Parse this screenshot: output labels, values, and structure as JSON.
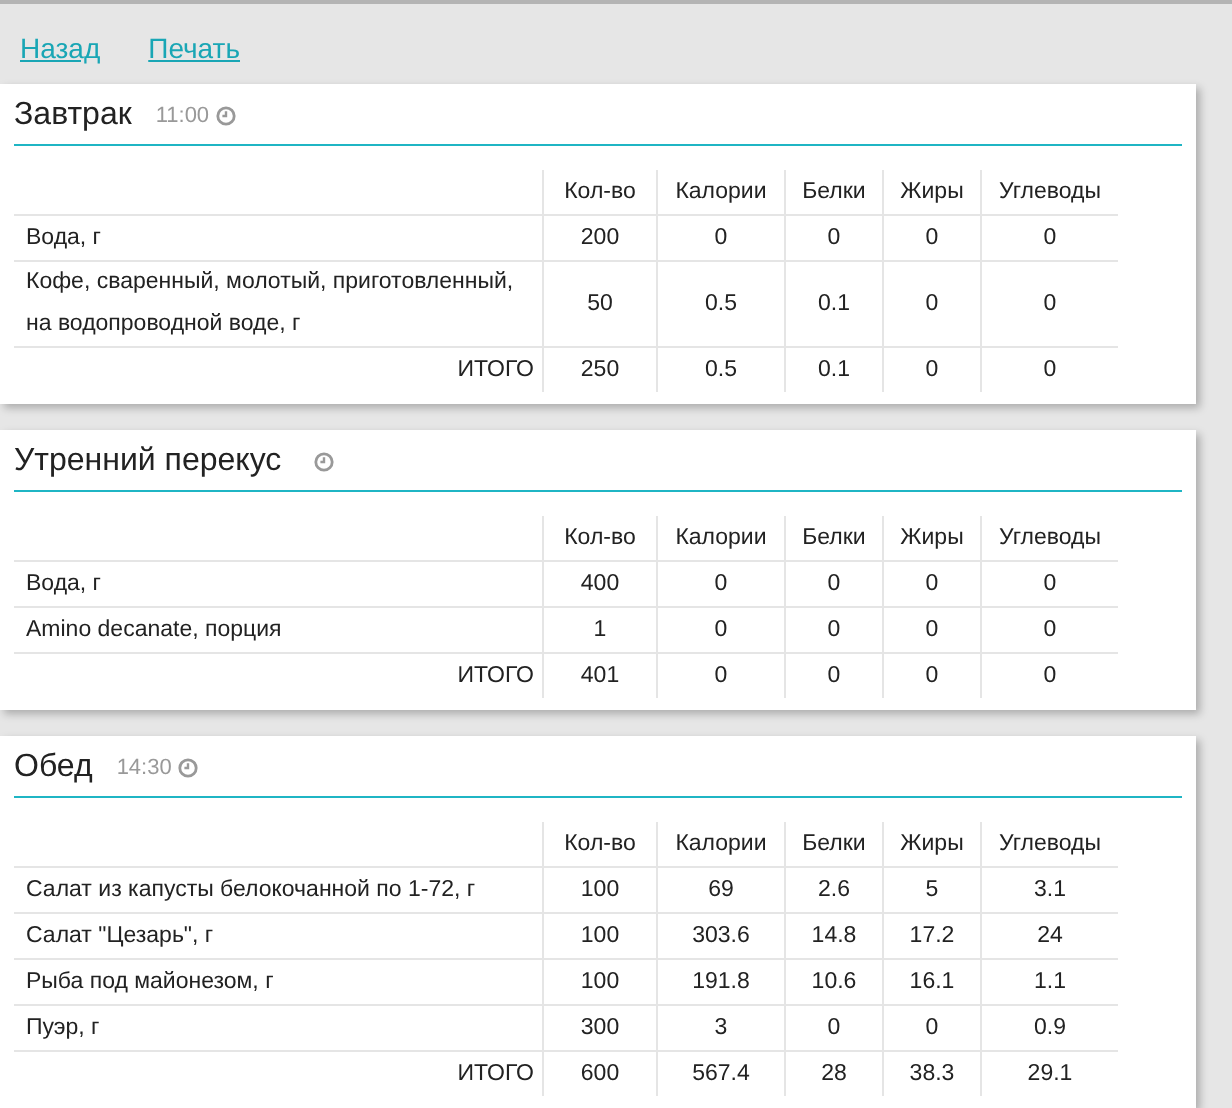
{
  "links": [
    "Назад",
    "Печать"
  ],
  "meals": [
    {
      "title": "Завтрак",
      "time": "11:00",
      "columns": [
        "Кол-во",
        "Калории",
        "Белки",
        "Жиры",
        "Углеводы"
      ],
      "rows": [
        {
          "name": "Вода, г",
          "values": [
            "200",
            "0",
            "0",
            "0",
            "0"
          ]
        },
        {
          "name": "Кофе, сваренный, молотый, приготовленный, на водопроводной воде, г",
          "values": [
            "50",
            "0.5",
            "0.1",
            "0",
            "0"
          ]
        }
      ],
      "total": {
        "label": "ИТОГО",
        "values": [
          "250",
          "0.5",
          "0.1",
          "0",
          "0"
        ]
      }
    },
    {
      "title": "Утренний перекус",
      "columns": [
        "Кол-во",
        "Калории",
        "Белки",
        "Жиры",
        "Углеводы"
      ],
      "rows": [
        {
          "name": "Вода, г",
          "values": [
            "400",
            "0",
            "0",
            "0",
            "0"
          ]
        },
        {
          "name": "Amino decanate, порция",
          "values": [
            "1",
            "0",
            "0",
            "0",
            "0"
          ]
        }
      ],
      "total": {
        "label": "ИТОГО",
        "values": [
          "401",
          "0",
          "0",
          "0",
          "0"
        ]
      }
    },
    {
      "title": "Обед",
      "time": "14:30",
      "columns": [
        "Кол-во",
        "Калории",
        "Белки",
        "Жиры",
        "Углеводы"
      ],
      "rows": [
        {
          "name": "Салат из капусты белокочанной по 1-72, г",
          "values": [
            "100",
            "69",
            "2.6",
            "5",
            "3.1"
          ]
        },
        {
          "name": "Салат \"Цезарь\", г",
          "values": [
            "100",
            "303.6",
            "14.8",
            "17.2",
            "24"
          ]
        },
        {
          "name": "Рыба под майонезом, г",
          "values": [
            "100",
            "191.8",
            "10.6",
            "16.1",
            "1.1"
          ]
        },
        {
          "name": "Пуэр, г",
          "values": [
            "300",
            "3",
            "0",
            "0",
            "0.9"
          ]
        }
      ],
      "total": {
        "label": "ИТОГО",
        "values": [
          "600",
          "567.4",
          "28",
          "38.3",
          "29.1"
        ]
      }
    }
  ]
}
